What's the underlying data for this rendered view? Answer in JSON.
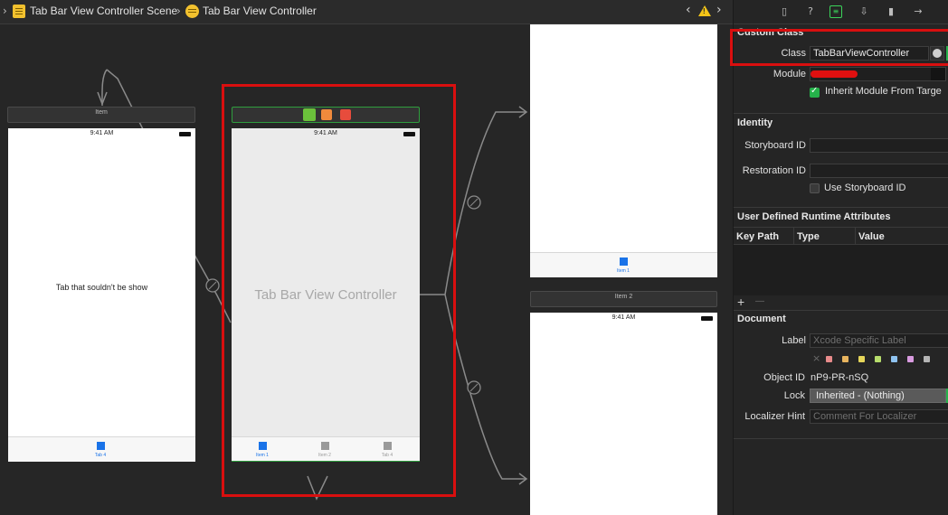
{
  "jumpbar": {
    "scene_label": "Tab Bar View Controller Scene",
    "controller_label": "Tab Bar View Controller",
    "scene_icon": "storyboard-scene-icon",
    "controller_icon": "view-controller-icon",
    "warning_icon": "warning-icon"
  },
  "canvas": {
    "scene_item": {
      "title": "Item",
      "time": "9:41 AM",
      "body_text": "Tab that souldn't be show",
      "tab_label": "Tab 4"
    },
    "tab_bar_controller": {
      "title_text": "Tab Bar View Controller",
      "time": "9:41 AM",
      "tabs": [
        "Item 1",
        "Item 2",
        "Tab 4"
      ]
    },
    "scene_item1": {
      "tab_label": "Item 1"
    },
    "scene_item2": {
      "title": "Item 2",
      "time": "9:41 AM"
    }
  },
  "inspector": {
    "tab_icons": [
      "file-icon",
      "help-icon",
      "identity-icon",
      "attributes-icon",
      "size-icon",
      "connections-icon"
    ],
    "custom_class": {
      "title": "Custom Class",
      "class_label": "Class",
      "class_value": "TabBarViewController",
      "module_label": "Module",
      "inherit_label": "Inherit Module From Targe"
    },
    "identity": {
      "title": "Identity",
      "storyboard_id_label": "Storyboard ID",
      "restoration_id_label": "Restoration ID",
      "use_storyboard_id_label": "Use Storyboard ID"
    },
    "runtime_attributes": {
      "title": "User Defined Runtime Attributes",
      "columns": [
        "Key Path",
        "Type",
        "Value"
      ],
      "add_label": "+",
      "remove_label": "—"
    },
    "document": {
      "title": "Document",
      "label_label": "Label",
      "label_placeholder": "Xcode Specific Label",
      "object_id_label": "Object ID",
      "object_id_value": "nP9-PR-nSQ",
      "lock_label": "Lock",
      "lock_value": "Inherited - (Nothing)",
      "localizer_label": "Localizer Hint",
      "localizer_placeholder": "Comment For Localizer",
      "label_colors": [
        "#e88b8b",
        "#e8b45e",
        "#e6d65a",
        "#b7dd6c",
        "#8fc3f0",
        "#d99be0",
        "#b5b5b5"
      ]
    }
  }
}
